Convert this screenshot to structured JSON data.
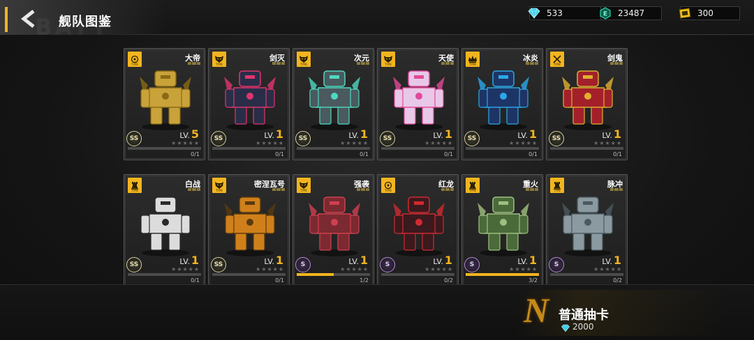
{
  "header": {
    "title": "舰队图鉴",
    "watermark": "BATT"
  },
  "currencies": [
    {
      "name": "diamond",
      "icon": "diamond-icon",
      "value": "533",
      "color": "#3fd0e8"
    },
    {
      "name": "energy",
      "icon": "energy-crystal-icon",
      "value": "23487",
      "color": "#2bd6a8"
    },
    {
      "name": "ticket",
      "icon": "ticket-icon",
      "value": "300",
      "color": "#f2c21f"
    }
  ],
  "cards": [
    {
      "name": "大帝",
      "grade": "SS",
      "level_label": "LV.",
      "level": "5",
      "count": "0/1",
      "progress": 0,
      "type_icon": "target-icon",
      "stars_filled": 0,
      "mech_color": "#c9a23a",
      "mech_accent": "#8a6a14"
    },
    {
      "name": "剑灭",
      "grade": "SS",
      "level_label": "LV.",
      "level": "1",
      "count": "0/1",
      "progress": 0,
      "type_icon": "tiger-head-icon",
      "stars_filled": 0,
      "mech_color": "#2a2d48",
      "mech_accent": "#e0356e"
    },
    {
      "name": "次元",
      "grade": "SS",
      "level_label": "LV.",
      "level": "1",
      "count": "0/1",
      "progress": 0,
      "type_icon": "tiger-head-icon",
      "stars_filled": 0,
      "mech_color": "#4a5a5e",
      "mech_accent": "#4fd8c0"
    },
    {
      "name": "天使",
      "grade": "SS",
      "level_label": "LV.",
      "level": "1",
      "count": "0/1",
      "progress": 0,
      "type_icon": "tiger-head-icon",
      "stars_filled": 0,
      "mech_color": "#e8c8e8",
      "mech_accent": "#e04a9a"
    },
    {
      "name": "冰炎",
      "grade": "SS",
      "level_label": "LV.",
      "level": "1",
      "count": "0/1",
      "progress": 0,
      "type_icon": "crown-icon",
      "stars_filled": 0,
      "mech_color": "#1d3566",
      "mech_accent": "#2aa8e8"
    },
    {
      "name": "剑鬼",
      "grade": "SS",
      "level_label": "LV.",
      "level": "1",
      "count": "0/1",
      "progress": 0,
      "type_icon": "crossed-swords-icon",
      "stars_filled": 0,
      "mech_color": "#a3202a",
      "mech_accent": "#e0b030"
    },
    {
      "name": "白战",
      "grade": "SS",
      "level_label": "LV.",
      "level": "1",
      "count": "0/1",
      "progress": 0,
      "type_icon": "chess-rook-icon",
      "stars_filled": 0,
      "mech_color": "#dcdcdc",
      "mech_accent": "#2a2a2a"
    },
    {
      "name": "密涅瓦号",
      "grade": "SS",
      "level_label": "LV.",
      "level": "1",
      "count": "0/1",
      "progress": 0,
      "type_icon": "tiger-head-icon",
      "stars_filled": 0,
      "mech_color": "#d0801a",
      "mech_accent": "#5a3a10"
    },
    {
      "name": "强袭",
      "grade": "S",
      "level_label": "LV.",
      "level": "1",
      "count": "1/2",
      "progress": 0.5,
      "type_icon": "tiger-head-icon",
      "stars_filled": 0,
      "mech_color": "#7a2a30",
      "mech_accent": "#d04050"
    },
    {
      "name": "红龙",
      "grade": "S",
      "level_label": "LV.",
      "level": "1",
      "count": "0/2",
      "progress": 0,
      "type_icon": "target-icon",
      "stars_filled": 0,
      "mech_color": "#3a1a1e",
      "mech_accent": "#d02a30"
    },
    {
      "name": "重火",
      "grade": "S",
      "level_label": "LV.",
      "level": "1",
      "count": "3/2",
      "progress": 1,
      "type_icon": "chess-rook-icon",
      "stars_filled": 0,
      "mech_color": "#4a6a3a",
      "mech_accent": "#a0c080"
    },
    {
      "name": "脉冲",
      "grade": "S",
      "level_label": "LV.",
      "level": "1",
      "count": "0/2",
      "progress": 0,
      "type_icon": "chess-rook-icon",
      "stars_filled": 0,
      "mech_color": "#8a9aa0",
      "mech_accent": "#4a5a60"
    }
  ],
  "type_badge_text": "TYPE",
  "draw": {
    "letter": "N",
    "title": "普通抽卡",
    "cost": "2000"
  }
}
